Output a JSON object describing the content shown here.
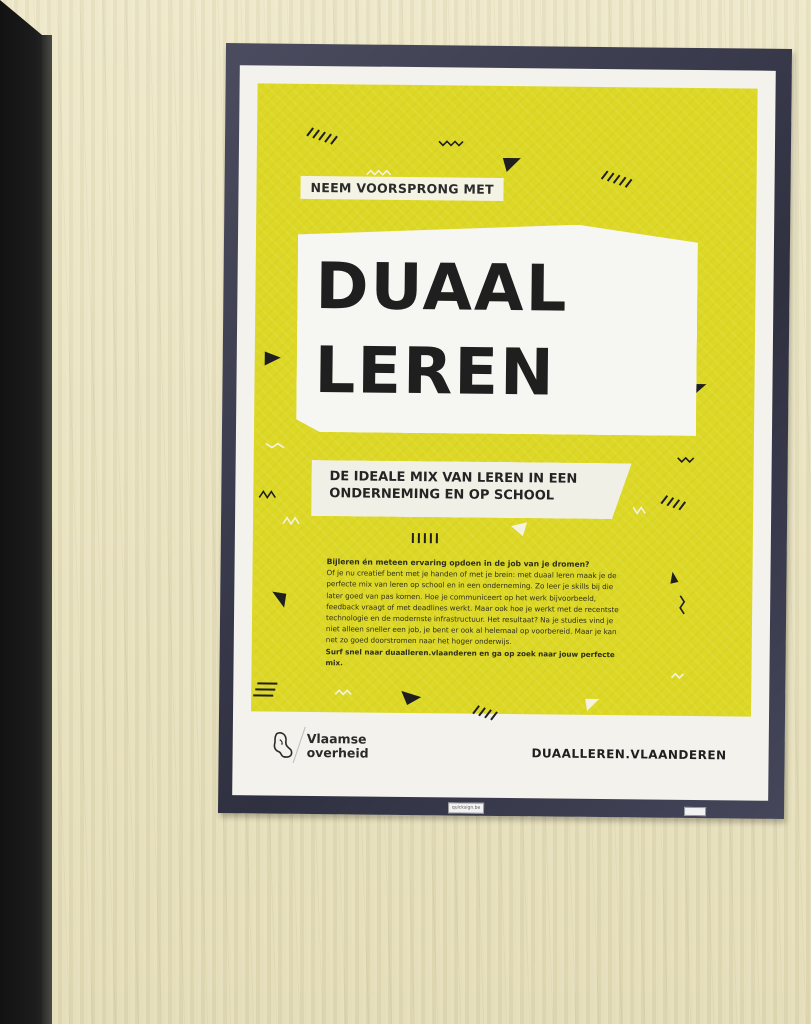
{
  "poster": {
    "tagline": "NEEM VOORSPRONG MET",
    "title_line1": "DUAAL",
    "title_line2": "LEREN",
    "subtitle": "DE IDEALE MIX VAN LEREN IN EEN\nONDERNEMING EN OP SCHOOL",
    "body_question": "Bijleren én meteen ervaring opdoen in de job van je dromen?",
    "body_text": "Of je nu creatief bent met je handen of met je brein: met duaal leren maak je de perfecte mix van leren op school en in een onderneming. Zo leer je skills bij die later goed van pas komen. Hoe je communiceert op het werk bijvoorbeeld, feedback vraagt of met deadlines werkt. Maar ook hoe je werkt met de recentste technologie en de modernste infrastructuur. Het resultaat? Na je studies vind je niet alleen sneller een job, je bent er ook al helemaal op voorbereid. Maar je kan net zo goed doorstromen naar het hoger onderwijs.",
    "body_cta": "Surf snel naar duaalleren.vlaanderen en ga op zoek naar jouw perfecte mix.",
    "logo_text": "Vlaamse\noverheid",
    "url": "DUAALLEREN.VLAANDEREN",
    "sticker": "quicksign.be"
  },
  "colors": {
    "poster_yellow": "#ddd825",
    "frame": "#3a3b4d",
    "wall": "#ece6c2",
    "text_dark": "#1f1f1f"
  }
}
